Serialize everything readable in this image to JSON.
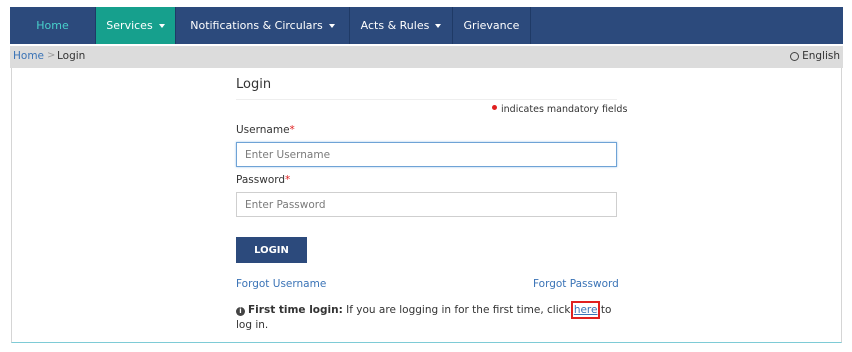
{
  "nav": {
    "items": [
      {
        "label": "Home",
        "dropdown": false
      },
      {
        "label": "Services",
        "dropdown": true,
        "active": true
      },
      {
        "label": "Notifications & Circulars",
        "dropdown": true
      },
      {
        "label": "Acts & Rules",
        "dropdown": true
      },
      {
        "label": "Grievance",
        "dropdown": false
      }
    ]
  },
  "breadcrumb": {
    "home": "Home",
    "separator": ">",
    "current": "Login"
  },
  "language": {
    "label": "English",
    "icon": "globe-icon"
  },
  "login": {
    "title": "Login",
    "mandatory_note": "indicates mandatory fields",
    "username": {
      "label": "Username",
      "required_mark": "*",
      "placeholder": "Enter Username",
      "value": ""
    },
    "password": {
      "label": "Password",
      "required_mark": "*",
      "placeholder": "Enter Password",
      "value": ""
    },
    "button_label": "LOGIN",
    "forgot_username": "Forgot Username",
    "forgot_password": "Forgot Password",
    "first_time": {
      "icon": "info-icon",
      "heading": "First time login:",
      "text_before": " If you are logging in for the first time, click ",
      "link": "here",
      "text_after": " to log in."
    }
  },
  "colors": {
    "nav_bg": "#2c4a7c",
    "nav_active_bg": "#16a08d",
    "nav_home_text": "#48d1cc",
    "link": "#3a73b6",
    "required": "#e02020",
    "highlight_box": "#e02020"
  }
}
